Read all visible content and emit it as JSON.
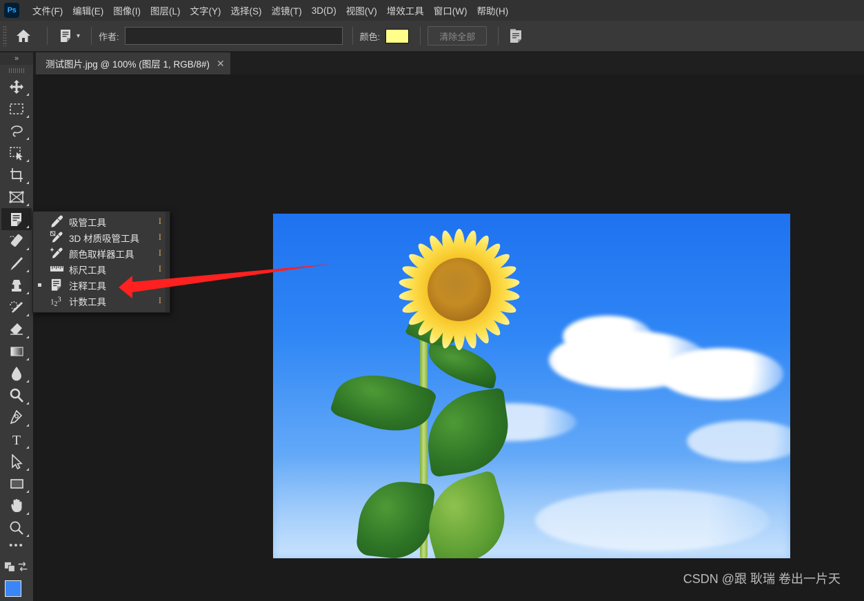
{
  "app": {
    "logo": "Ps"
  },
  "menubar": {
    "items": [
      {
        "label": "文件(F)"
      },
      {
        "label": "编辑(E)"
      },
      {
        "label": "图像(I)"
      },
      {
        "label": "图层(L)"
      },
      {
        "label": "文字(Y)"
      },
      {
        "label": "选择(S)"
      },
      {
        "label": "滤镜(T)"
      },
      {
        "label": "3D(D)"
      },
      {
        "label": "视图(V)"
      },
      {
        "label": "增效工具"
      },
      {
        "label": "窗口(W)"
      },
      {
        "label": "帮助(H)"
      }
    ]
  },
  "options_bar": {
    "home_icon": "home-icon",
    "tool_preset_icon": "note-tool-icon",
    "preset_chevron": "chevron-down-icon",
    "author_label": "作者:",
    "author_value": "",
    "author_placeholder": "",
    "color_label": "颜色:",
    "color_value": "#FFFF8A",
    "clear_all_label": "清除全部",
    "notes_panel_icon": "notes-panel-icon"
  },
  "tab": {
    "title": "测试图片.jpg @ 100% (图层 1, RGB/8#)",
    "close_label": "✕"
  },
  "toolbar": {
    "collapse_label": "»",
    "tools": [
      {
        "name": "move-tool",
        "glyph": "move"
      },
      {
        "name": "rectangular-marquee-tool",
        "glyph": "marquee"
      },
      {
        "name": "lasso-tool",
        "glyph": "lasso"
      },
      {
        "name": "object-selection-tool",
        "glyph": "objectselect"
      },
      {
        "name": "crop-tool",
        "glyph": "crop"
      },
      {
        "name": "frame-tool",
        "glyph": "frame"
      },
      {
        "name": "note-tool",
        "glyph": "note",
        "active": true
      },
      {
        "name": "spot-healing-brush-tool",
        "glyph": "healing"
      },
      {
        "name": "brush-tool",
        "glyph": "brush"
      },
      {
        "name": "clone-stamp-tool",
        "glyph": "stamp"
      },
      {
        "name": "history-brush-tool",
        "glyph": "historybrush"
      },
      {
        "name": "eraser-tool",
        "glyph": "eraser"
      },
      {
        "name": "gradient-tool",
        "glyph": "gradient"
      },
      {
        "name": "blur-tool",
        "glyph": "blur"
      },
      {
        "name": "dodge-tool",
        "glyph": "dodge"
      },
      {
        "name": "pen-tool",
        "glyph": "pen"
      },
      {
        "name": "horizontal-type-tool",
        "glyph": "type"
      },
      {
        "name": "path-selection-tool",
        "glyph": "pathselect"
      },
      {
        "name": "rectangle-tool",
        "glyph": "rectangle"
      },
      {
        "name": "hand-tool",
        "glyph": "hand"
      },
      {
        "name": "zoom-tool",
        "glyph": "zoom"
      }
    ],
    "more_tools_label": "•••",
    "edit_toolbar_icon": "ellipsis-icon",
    "quickmask_icon": "quick-mask-icon",
    "screenmode_icon": "screen-mode-icon",
    "foreground_color": "#3A86F7",
    "background_color": "#FFFFFF"
  },
  "flyout_menu": {
    "items": [
      {
        "label": "吸管工具",
        "shortcut": "I",
        "icon": "eyedropper-icon",
        "selected": false
      },
      {
        "label": "3D 材质吸管工具",
        "shortcut": "I",
        "icon": "material-eyedropper-icon",
        "selected": false
      },
      {
        "label": "颜色取样器工具",
        "shortcut": "I",
        "icon": "color-sampler-icon",
        "selected": false
      },
      {
        "label": "标尺工具",
        "shortcut": "I",
        "icon": "ruler-icon",
        "selected": false
      },
      {
        "label": "注释工具",
        "shortcut": "I",
        "icon": "note-icon",
        "selected": true
      },
      {
        "label": "计数工具",
        "shortcut": "I",
        "icon": "count-icon",
        "selected": false
      }
    ]
  },
  "annotation": {
    "arrow_color": "#FF2020",
    "arrow_from": "460,390",
    "arrow_to": "175,417"
  },
  "watermark": {
    "text": "CSDN @跟 耿瑞 卷出一片天"
  }
}
